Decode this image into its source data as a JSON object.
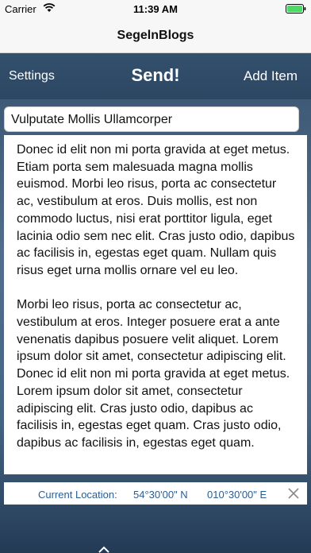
{
  "status_bar": {
    "carrier": "Carrier",
    "time": "11:39 AM",
    "wifi_icon": "wifi-icon",
    "battery_icon": "battery-icon",
    "battery_color": "#4cd964"
  },
  "app": {
    "title": "SegelnBlogs"
  },
  "toolbar": {
    "settings_label": "Settings",
    "send_label": "Send!",
    "add_label": "Add Item"
  },
  "post": {
    "title": "Vulputate Mollis Ullamcorper",
    "paragraphs": [
      "Donec id elit non mi porta gravida at eget metus. Etiam porta sem malesuada magna mollis euismod. Morbi leo risus, porta ac consectetur ac, vestibulum at eros. Duis mollis, est non commodo luctus, nisi erat porttitor ligula, eget lacinia odio sem nec elit. Cras justo odio, dapibus ac facilisis in, egestas eget quam. Nullam quis risus eget urna mollis ornare vel eu leo.",
      "Morbi leo risus, porta ac consectetur ac, vestibulum at eros. Integer posuere erat a ante venenatis dapibus posuere velit aliquet. Lorem ipsum dolor sit amet, consectetur adipiscing elit. Donec id elit non mi porta gravida at eget metus. Lorem ipsum dolor sit amet, consectetur adipiscing elit. Cras justo odio, dapibus ac facilisis in, egestas eget quam. Cras justo odio, dapibus ac facilisis in, egestas eget quam."
    ]
  },
  "location": {
    "label": "Current Location:",
    "latitude": "54°30'00\" N",
    "longitude": "010°30'00\" E",
    "close_icon": "close-icon",
    "text_color": "#2a5d94"
  },
  "colors": {
    "toolbar_bg": "#2e4660",
    "toolbar_text": "#ffffff"
  }
}
